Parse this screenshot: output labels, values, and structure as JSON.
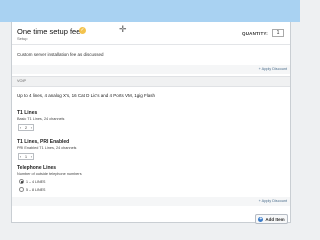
{
  "colors": {
    "topbar": "#a9d2f2",
    "accent": "#3a7bc8",
    "link": "#4a6d8c"
  },
  "item1": {
    "title": "One time setup fee",
    "subtitle": "Setup",
    "status_icon": "check-circle-icon",
    "move_icon": "move-cross-icon",
    "quantity_label": "QUANTITY:",
    "quantity_value": "1",
    "description": "Custom server installation fee as discussed",
    "apply_discount": "+ Apply Discount"
  },
  "item2": {
    "label": "VOIP",
    "summary": "Up to 4 lines, 4 analog X's, 16 Cat D Lic's and 4 Ports VM, 1gig Flash",
    "options": [
      {
        "title": "T1 Lines",
        "description": "Basic T1 Lines, 24 channels",
        "value": "2"
      },
      {
        "title": "T1 Lines, PRI Enabled",
        "description": "PRI Enabled T1 Lines, 24 channels",
        "value": "1"
      }
    ],
    "telephone": {
      "title": "Telephone Lines",
      "description": "Number of outside telephone numbers",
      "choices": [
        {
          "label": "1 – 4 LINES",
          "selected": true
        },
        {
          "label": "5 – 8 LINES",
          "selected": false
        }
      ]
    },
    "apply_discount": "+ Apply Discount"
  },
  "add_item": {
    "label": "Add Item",
    "icon": "plus-icon"
  }
}
